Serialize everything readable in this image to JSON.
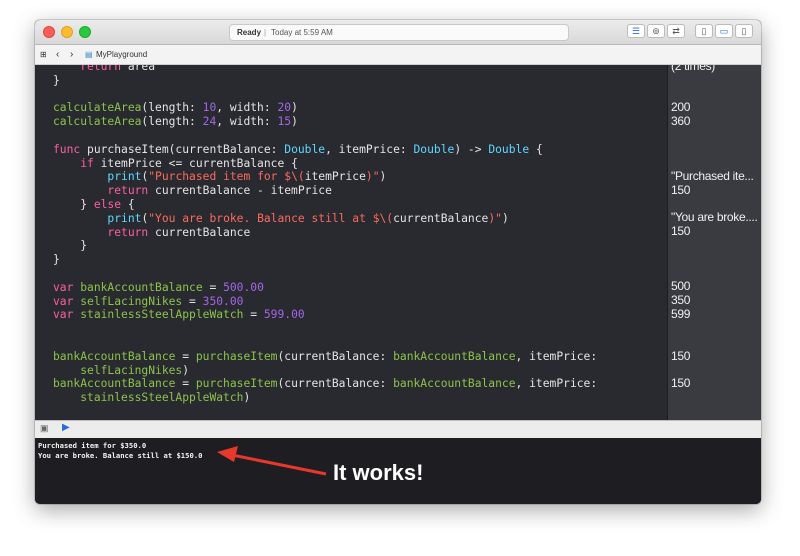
{
  "window": {
    "status": {
      "ready": "Ready",
      "separator": "|",
      "time": "Today at 5:59 AM"
    },
    "breadcrumb": {
      "file": "MyPlayground"
    }
  },
  "code_lines": [
    "    return area",
    "}",
    "",
    "calculateArea(length: 10, width: 20)",
    "calculateArea(length: 24, width: 15)",
    "",
    "func purchaseItem(currentBalance: Double, itemPrice: Double) -> Double {",
    "    if itemPrice <= currentBalance {",
    "        print(\"Purchased item for $\\(itemPrice)\")",
    "        return currentBalance - itemPrice",
    "    } else {",
    "        print(\"You are broke. Balance still at $\\(currentBalance)\")",
    "        return currentBalance",
    "    }",
    "}",
    "",
    "var bankAccountBalance = 500.00",
    "var selfLacingNikes = 350.00",
    "var stainlessSteelAppleWatch = 599.00",
    "",
    "",
    "bankAccountBalance = purchaseItem(currentBalance: bankAccountBalance, itemPrice:",
    "    selfLacingNikes)",
    "bankAccountBalance = purchaseItem(currentBalance: bankAccountBalance, itemPrice:",
    "    stainlessSteelAppleWatch)"
  ],
  "results": {
    "r0": "(2 times)",
    "r1": "200",
    "r2": "360",
    "r3": "\"Purchased ite...",
    "r4": "150",
    "r5": "\"You are broke....",
    "r6": "150",
    "r7": "500",
    "r8": "350",
    "r9": "599",
    "r10": "150",
    "r11": "150"
  },
  "console": {
    "line1": "Purchased item for $350.0",
    "line2": "You are broke. Balance still at $150.0"
  },
  "annotation": {
    "text": "It works!",
    "color": "#e8372b"
  },
  "colors": {
    "editor_bg": "#292a30",
    "results_bg": "#3a3b41",
    "keyword": "#fc5fa3",
    "type": "#5dd8ff",
    "string": "#fc6a5d",
    "number": "#d0bf69",
    "identifier": "#8bc34a"
  }
}
